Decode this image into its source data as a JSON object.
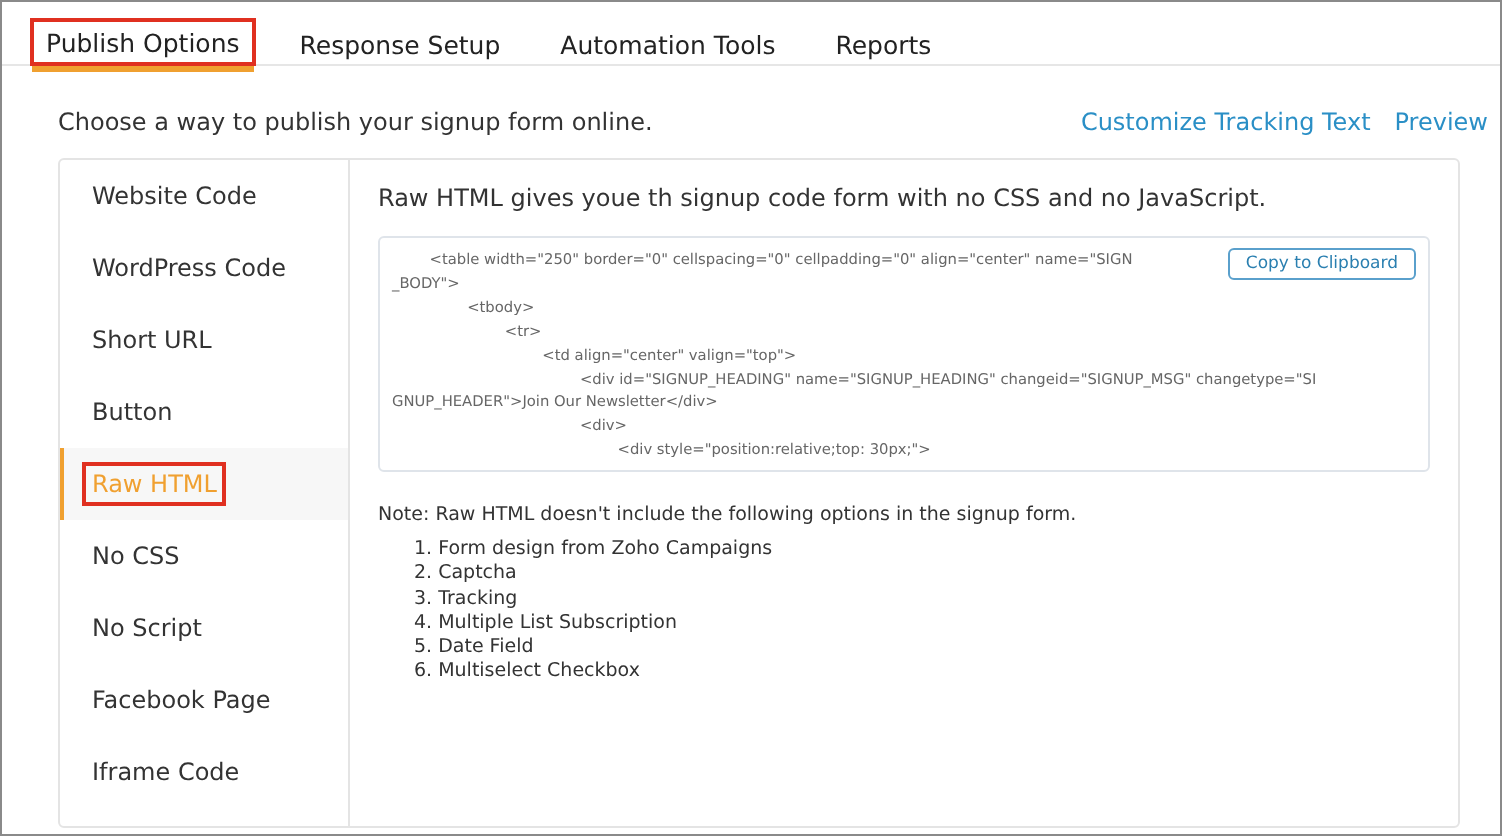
{
  "tabs": [
    {
      "label": "Publish Options",
      "selected": true,
      "highlighted": true
    },
    {
      "label": "Response Setup",
      "selected": false,
      "highlighted": false
    },
    {
      "label": "Automation Tools",
      "selected": false,
      "highlighted": false
    },
    {
      "label": "Reports",
      "selected": false,
      "highlighted": false
    }
  ],
  "intro": "Choose a way to publish your signup form online.",
  "links": [
    "Customize Tracking Text",
    "Preview"
  ],
  "sidebar": {
    "items": [
      {
        "label": "Website Code",
        "selected": false,
        "highlighted": false
      },
      {
        "label": "WordPress Code",
        "selected": false,
        "highlighted": false
      },
      {
        "label": "Short URL",
        "selected": false,
        "highlighted": false
      },
      {
        "label": "Button",
        "selected": false,
        "highlighted": false
      },
      {
        "label": "Raw HTML",
        "selected": true,
        "highlighted": true
      },
      {
        "label": "No CSS",
        "selected": false,
        "highlighted": false
      },
      {
        "label": "No Script",
        "selected": false,
        "highlighted": false
      },
      {
        "label": "Facebook Page",
        "selected": false,
        "highlighted": false
      },
      {
        "label": "Iframe Code",
        "selected": false,
        "highlighted": false
      }
    ]
  },
  "description": "Raw HTML gives youe th signup code form with no CSS and no JavaScript.",
  "code_lines": [
    "        <table width=\"250\" border=\"0\" cellspacing=\"0\" cellpadding=\"0\" align=\"center\" name=\"SIGN",
    "_BODY\">",
    "                <tbody>",
    "                        <tr>",
    "                                <td align=\"center\" valign=\"top\">",
    "                                        <div id=\"SIGNUP_HEADING\" name=\"SIGNUP_HEADING\" changeid=\"SIGNUP_MSG\" changetype=\"SI",
    "GNUP_HEADER\">Join Our Newsletter</div>",
    "                                        <div>",
    "                                                <div style=\"position:relative;top: 30px;\">"
  ],
  "copy_button": "Copy to Clipboard",
  "note": "Note: Raw HTML doesn't include the following options in the signup form.",
  "options": [
    "1. Form design from Zoho Campaigns",
    "2. Captcha",
    "3. Tracking",
    "4. Multiple List Subscription",
    "5. Date Field",
    "6. Multiselect Checkbox"
  ]
}
